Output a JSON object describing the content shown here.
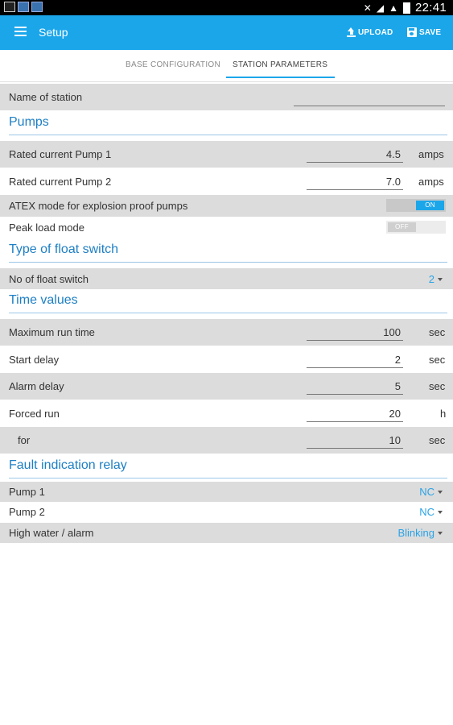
{
  "status_bar": {
    "time": "22:41"
  },
  "app_bar": {
    "title": "Setup",
    "upload_label": "UPLOAD",
    "save_label": "SAVE"
  },
  "tabs": [
    {
      "label": "BASE CONFIGURATION"
    },
    {
      "label": "STATION PARAMETERS"
    }
  ],
  "station": {
    "name_label": "Name of station",
    "name_value": ""
  },
  "pumps": {
    "heading": "Pumps",
    "rated1_label": "Rated current Pump 1",
    "rated1_value": "4.5",
    "rated1_unit": "amps",
    "rated2_label": "Rated current Pump 2",
    "rated2_value": "7.0",
    "rated2_unit": "amps",
    "atex_label": "ATEX mode for explosion proof pumps",
    "atex_state": "ON",
    "peak_label": "Peak load mode",
    "peak_state": "OFF"
  },
  "float_switch": {
    "heading": "Type of float switch",
    "count_label": "No of float switch",
    "count_value": "2"
  },
  "time_values": {
    "heading": "Time values",
    "max_run_label": "Maximum run time",
    "max_run_value": "100",
    "max_run_unit": "sec",
    "start_delay_label": "Start delay",
    "start_delay_value": "2",
    "start_delay_unit": "sec",
    "alarm_delay_label": "Alarm delay",
    "alarm_delay_value": "5",
    "alarm_delay_unit": "sec",
    "forced_run_label": "Forced run",
    "forced_run_value": "20",
    "forced_run_unit": "h",
    "for_label": "for",
    "for_value": "10",
    "for_unit": "sec"
  },
  "fault_relay": {
    "heading": "Fault indication relay",
    "pump1_label": "Pump 1",
    "pump1_value": "NC",
    "pump2_label": "Pump 2",
    "pump2_value": "NC",
    "high_water_label": "High water / alarm",
    "high_water_value": "Blinking"
  },
  "colors": {
    "accent": "#1ba6ea",
    "section_text": "#1d7fc4",
    "row_gray": "#dcdcdc"
  }
}
